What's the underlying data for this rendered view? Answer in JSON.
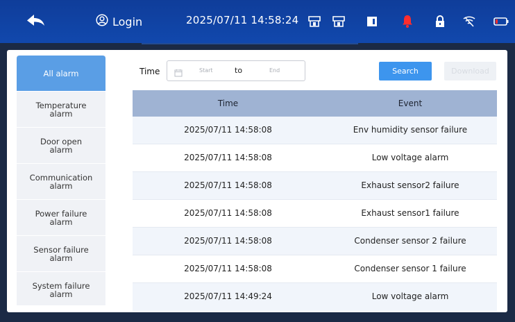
{
  "topbar": {
    "back_icon": "back-arrow-icon",
    "login_icon": "user-circle-icon",
    "login_label": "Login",
    "datetime": "2025/07/11 14:58:24",
    "icons": [
      "unit-a-icon",
      "unit-b-icon",
      "door-icon",
      "alarm-bell-icon",
      "lock-icon",
      "wifi-icon",
      "battery-icon"
    ],
    "alarm_color": "#ff2d2d"
  },
  "sidebar": {
    "items": [
      {
        "label": "All alarm"
      },
      {
        "label": "Temperature\nalarm"
      },
      {
        "label": "Door open\nalarm"
      },
      {
        "label": "Communication\nalarm"
      },
      {
        "label": "Power failure\nalarm"
      },
      {
        "label": "Sensor failure\nalarm"
      },
      {
        "label": "System failure\nalarm"
      }
    ]
  },
  "filter": {
    "time_label": "Time",
    "start_placeholder": "Start",
    "to_label": "to",
    "end_placeholder": "End",
    "search_label": "Search",
    "download_label": "Download"
  },
  "table": {
    "headers": [
      "Time",
      "Event"
    ],
    "rows": [
      {
        "time": "2025/07/11 14:58:08",
        "event": "Env humidity sensor failure"
      },
      {
        "time": "2025/07/11 14:58:08",
        "event": "Low voltage alarm"
      },
      {
        "time": "2025/07/11 14:58:08",
        "event": "Exhaust sensor2 failure"
      },
      {
        "time": "2025/07/11 14:58:08",
        "event": "Exhaust sensor1 failure"
      },
      {
        "time": "2025/07/11 14:58:08",
        "event": "Condenser sensor 2 failure"
      },
      {
        "time": "2025/07/11 14:58:08",
        "event": "Condenser sensor 1 failure"
      },
      {
        "time": "2025/07/11 14:49:24",
        "event": "Low voltage alarm"
      }
    ]
  },
  "colors": {
    "topbar": "#1148ad",
    "accent": "#3d95ee",
    "active_tab": "#5a9ee5",
    "table_header": "#9fb3d3"
  }
}
